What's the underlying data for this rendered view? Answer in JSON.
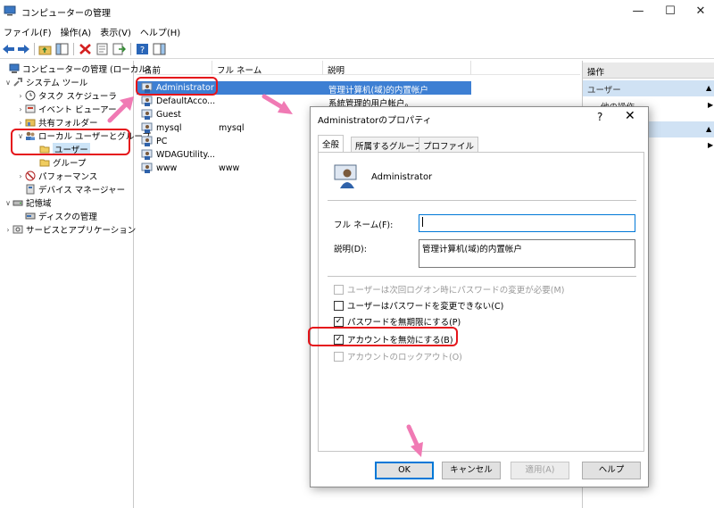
{
  "window": {
    "title": "コンピューターの管理",
    "minimize_glyph": "—",
    "maximize_glyph": "☐",
    "close_glyph": "✕"
  },
  "menu": [
    "ファイル(F)",
    "操作(A)",
    "表示(V)",
    "ヘルプ(H)"
  ],
  "tree": [
    {
      "label": "コンピューターの管理 (ローカル)",
      "indent": 0,
      "expander": "",
      "icon": "computer-management-icon"
    },
    {
      "label": "システム ツール",
      "indent": 1,
      "expander": "∨",
      "icon": "system-tools-icon"
    },
    {
      "label": "タスク スケジューラ",
      "indent": 2,
      "expander": "›",
      "icon": "task-scheduler-icon"
    },
    {
      "label": "イベント ビューアー",
      "indent": 2,
      "expander": "›",
      "icon": "event-viewer-icon"
    },
    {
      "label": "共有フォルダー",
      "indent": 2,
      "expander": "›",
      "icon": "shared-folders-icon"
    },
    {
      "label": "ローカル ユーザーとグループ",
      "indent": 2,
      "expander": "∨",
      "icon": "local-users-groups-icon"
    },
    {
      "label": "ユーザー",
      "indent": 3,
      "expander": "",
      "icon": "folder-icon",
      "selected": true
    },
    {
      "label": "グループ",
      "indent": 3,
      "expander": "",
      "icon": "folder-icon"
    },
    {
      "label": "パフォーマンス",
      "indent": 2,
      "expander": "›",
      "icon": "performance-icon"
    },
    {
      "label": "デバイス マネージャー",
      "indent": 2,
      "expander": "",
      "icon": "device-manager-icon"
    },
    {
      "label": "記憶域",
      "indent": 1,
      "expander": "∨",
      "icon": "storage-icon"
    },
    {
      "label": "ディスクの管理",
      "indent": 2,
      "expander": "",
      "icon": "disk-management-icon"
    },
    {
      "label": "サービスとアプリケーション",
      "indent": 1,
      "expander": "›",
      "icon": "services-apps-icon"
    }
  ],
  "list": {
    "headers": [
      "名前",
      "フル ネーム",
      "説明"
    ],
    "rows": [
      {
        "name": "Administrator",
        "full_name": "",
        "description": "管理计算机(域)的内置帐户",
        "selected": true
      },
      {
        "name": "DefaultAcco...",
        "full_name": "",
        "description": "系統管理的用户帐户。"
      },
      {
        "name": "Guest",
        "full_name": "",
        "description": ""
      },
      {
        "name": "mysql",
        "full_name": "mysql",
        "description": ""
      },
      {
        "name": "PC",
        "full_name": "",
        "description": ""
      },
      {
        "name": "WDAGUtility...",
        "full_name": "",
        "description": ""
      },
      {
        "name": "www",
        "full_name": "www",
        "description": ""
      }
    ]
  },
  "actions": {
    "header": "操作",
    "section": "ユーザー",
    "sub": "他の操作"
  },
  "dialog": {
    "title": "Administratorのプロパティ",
    "help_glyph": "?",
    "close_glyph": "✕",
    "tabs": [
      "全般",
      "所属するグループ",
      "プロファイル"
    ],
    "username": "Administrator",
    "full_name_label": "フル ネーム(F):",
    "full_name_value": "",
    "description_label": "説明(D):",
    "description_value": "管理计算机(域)的内置帐户",
    "checkboxes": [
      {
        "label": "ユーザーは次回ログオン時にパスワードの変更が必要(M)",
        "checked": false,
        "disabled": true
      },
      {
        "label": "ユーザーはパスワードを変更できない(C)",
        "checked": false,
        "disabled": false
      },
      {
        "label": "パスワードを無期限にする(P)",
        "checked": true,
        "disabled": false
      },
      {
        "label": "アカウントを無効にする(B)",
        "checked": true,
        "disabled": false
      },
      {
        "label": "アカウントのロックアウト(O)",
        "checked": false,
        "disabled": true
      }
    ],
    "buttons": {
      "ok": "OK",
      "cancel": "キャンセル",
      "apply": "適用(A)",
      "help": "ヘルプ"
    }
  },
  "colors": {
    "selection": "#3d7fd3",
    "annotation_red": "#e5151b",
    "annotation_arrow": "#f07ab4",
    "accent": "#0078d7"
  }
}
